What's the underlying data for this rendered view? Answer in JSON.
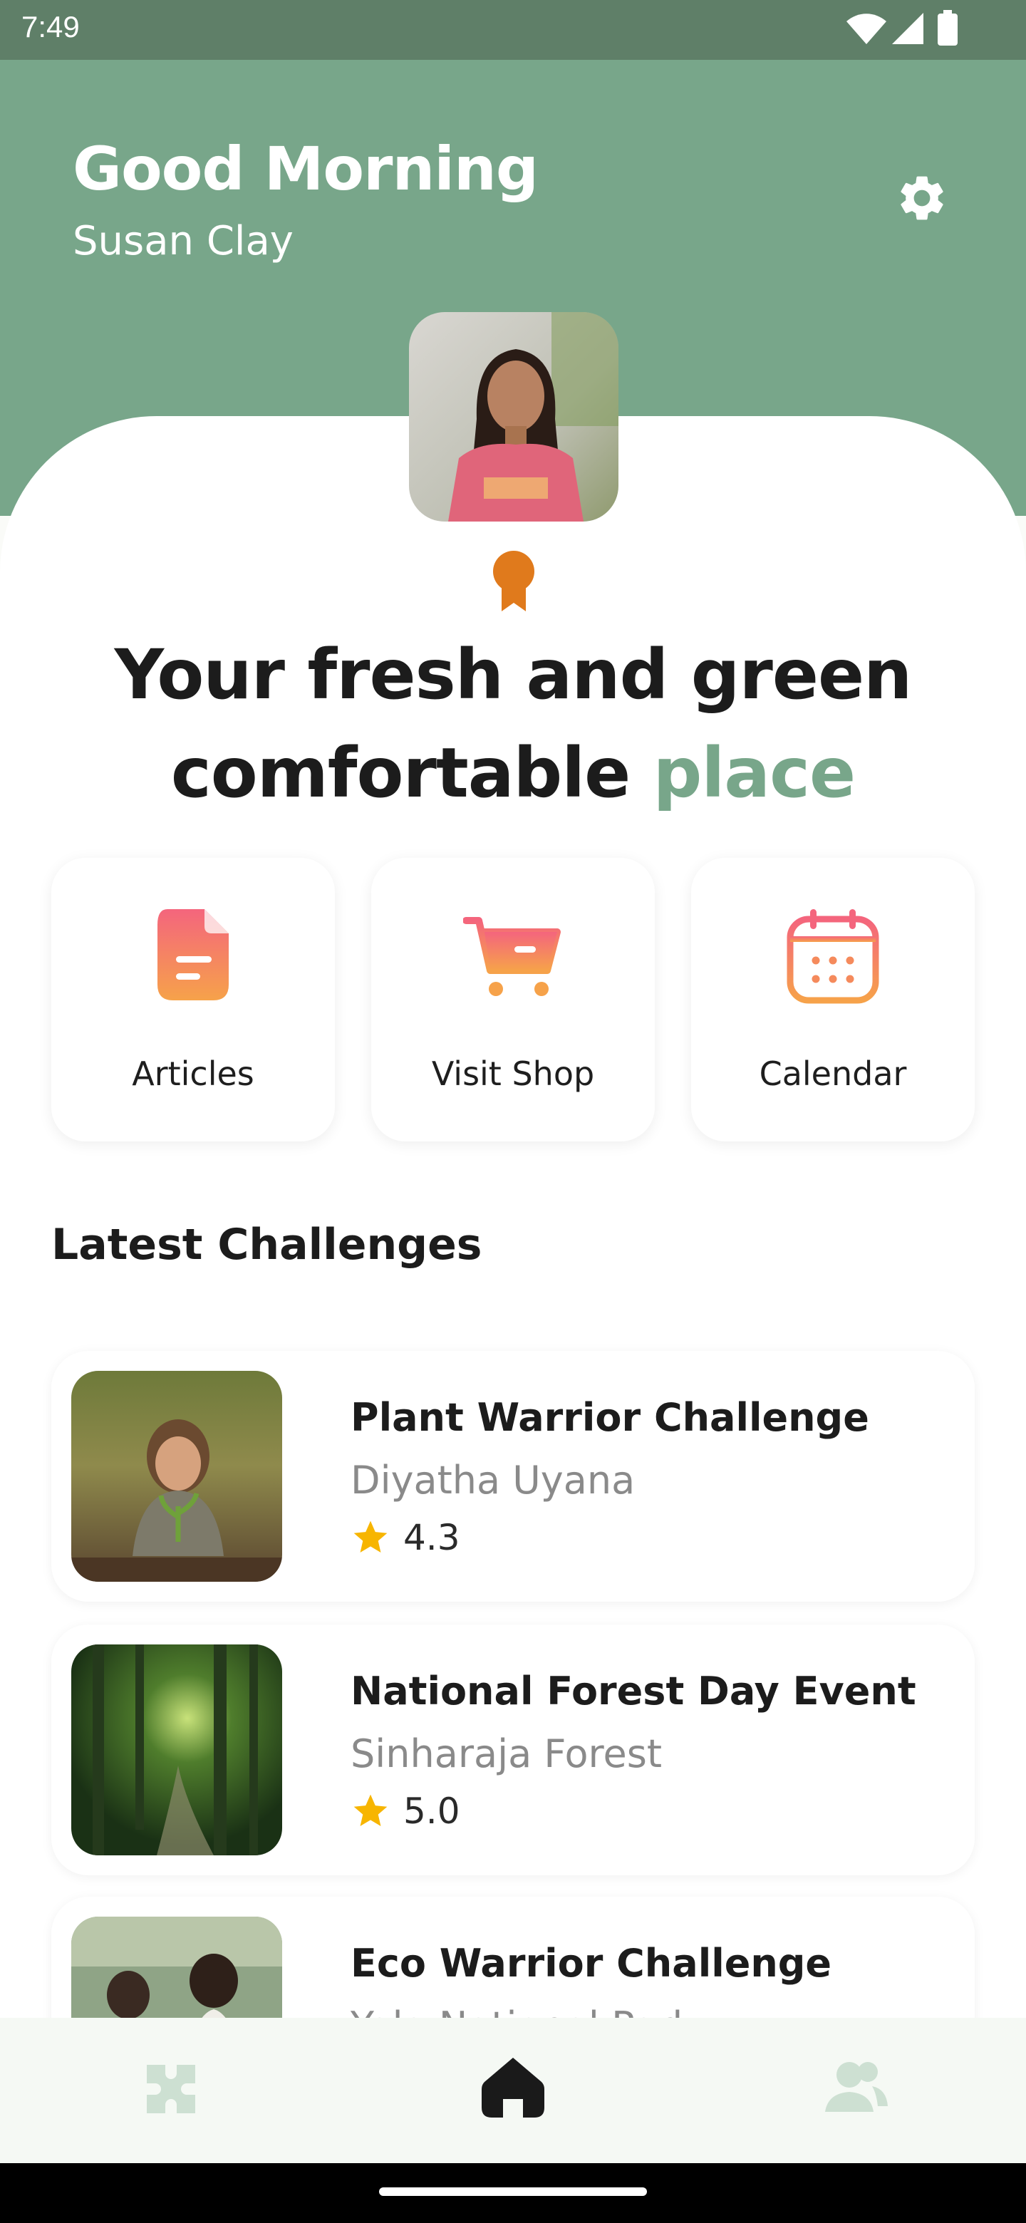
{
  "status_bar": {
    "time": "7:49"
  },
  "header": {
    "greeting": "Good Morning",
    "user_name": "Susan Clay"
  },
  "hero": {
    "headline_line1": "Your fresh and green",
    "headline_line2_main": "comfortable",
    "headline_line2_accent": "place"
  },
  "quick_actions": [
    {
      "label": "Articles",
      "icon": "document-icon"
    },
    {
      "label": "Visit Shop",
      "icon": "cart-icon"
    },
    {
      "label": "Calendar",
      "icon": "calendar-icon"
    }
  ],
  "challenges_section": {
    "title": "Latest Challenges",
    "items": [
      {
        "title": "Plant Warrior Challenge",
        "location": "Diyatha Uyana",
        "rating": "4.3"
      },
      {
        "title": "National Forest Day Event",
        "location": "Sinharaja Forest",
        "rating": "5.0"
      },
      {
        "title": "Eco Warrior Challenge",
        "location": "Yala National Park",
        "rating": ""
      }
    ]
  },
  "bottom_nav": [
    {
      "name": "challenges",
      "icon": "puzzle-icon",
      "active": false
    },
    {
      "name": "home",
      "icon": "home-icon",
      "active": true
    },
    {
      "name": "community",
      "icon": "users-icon",
      "active": false
    }
  ],
  "colors": {
    "primary_green": "#78a68a",
    "accent_gradient_start": "#f4657d",
    "accent_gradient_end": "#f6a24a",
    "award": "#e07a1c",
    "star": "#f7b500"
  }
}
